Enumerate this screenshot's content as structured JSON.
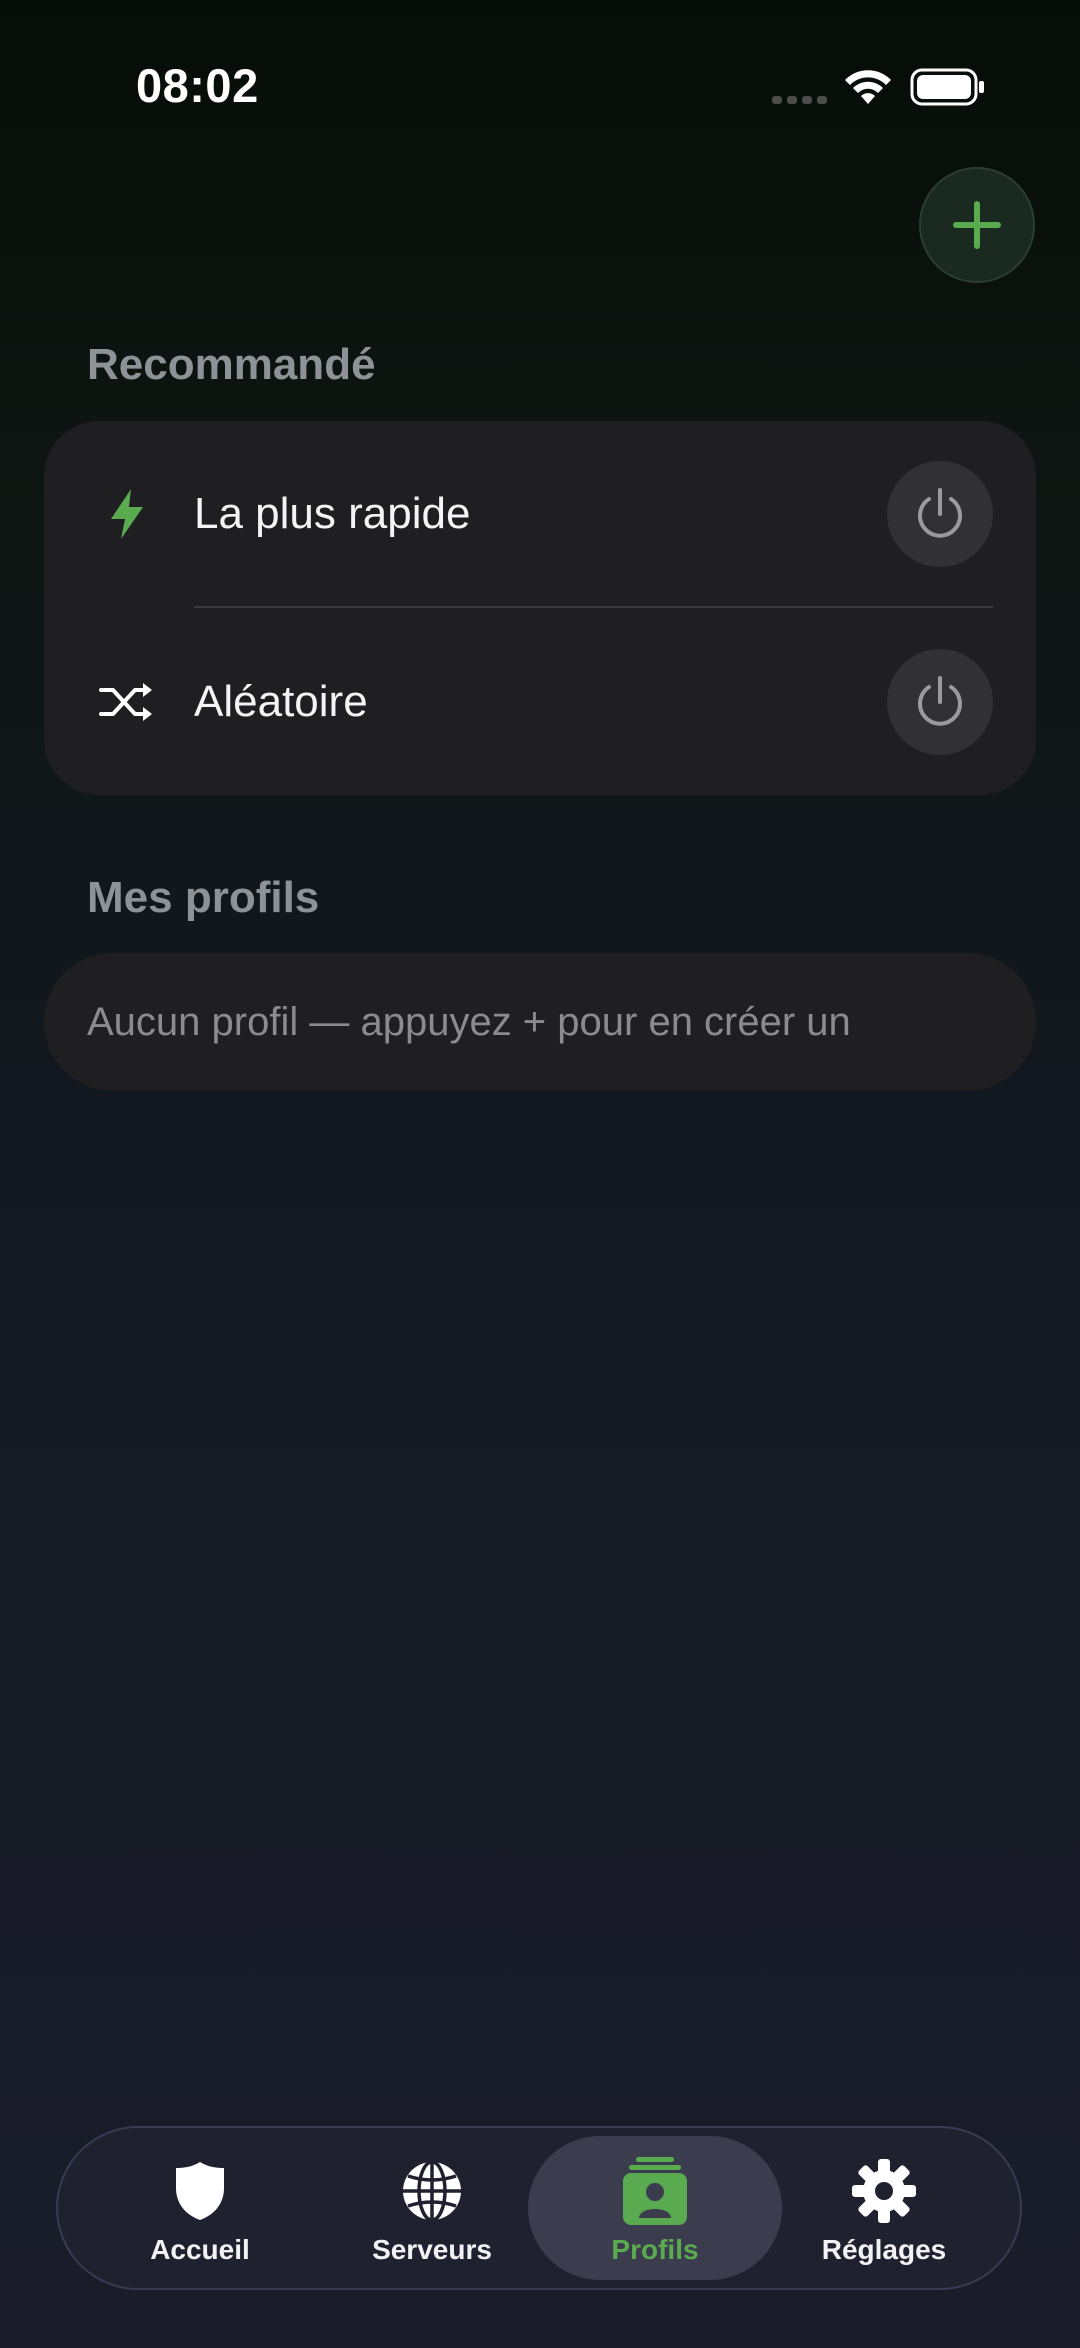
{
  "status_bar": {
    "time": "08:02",
    "icons": [
      "cellular-signal-icon",
      "wifi-icon",
      "battery-icon"
    ]
  },
  "header": {
    "add_icon": "plus-icon"
  },
  "recommended": {
    "title": "Recommandé",
    "items": [
      {
        "label": "La plus rapide",
        "icon": "lightning-bolt-icon",
        "action_icon": "power-icon"
      },
      {
        "label": "Aléatoire",
        "icon": "shuffle-icon",
        "action_icon": "power-icon"
      }
    ]
  },
  "my_profiles": {
    "title": "Mes profils",
    "empty_text": "Aucun profil — appuyez + pour en créer un"
  },
  "tab_bar": {
    "tabs": [
      {
        "label": "Accueil",
        "icon": "shield-icon",
        "active": false
      },
      {
        "label": "Serveurs",
        "icon": "globe-icon",
        "active": false
      },
      {
        "label": "Profils",
        "icon": "profile-card-icon",
        "active": true
      },
      {
        "label": "Réglages",
        "icon": "gear-icon",
        "active": false
      }
    ]
  },
  "colors": {
    "accent": "#5aaa50",
    "card": "#1f1f22",
    "section_title": "#8e9196",
    "tab_bar": "#20212e"
  }
}
